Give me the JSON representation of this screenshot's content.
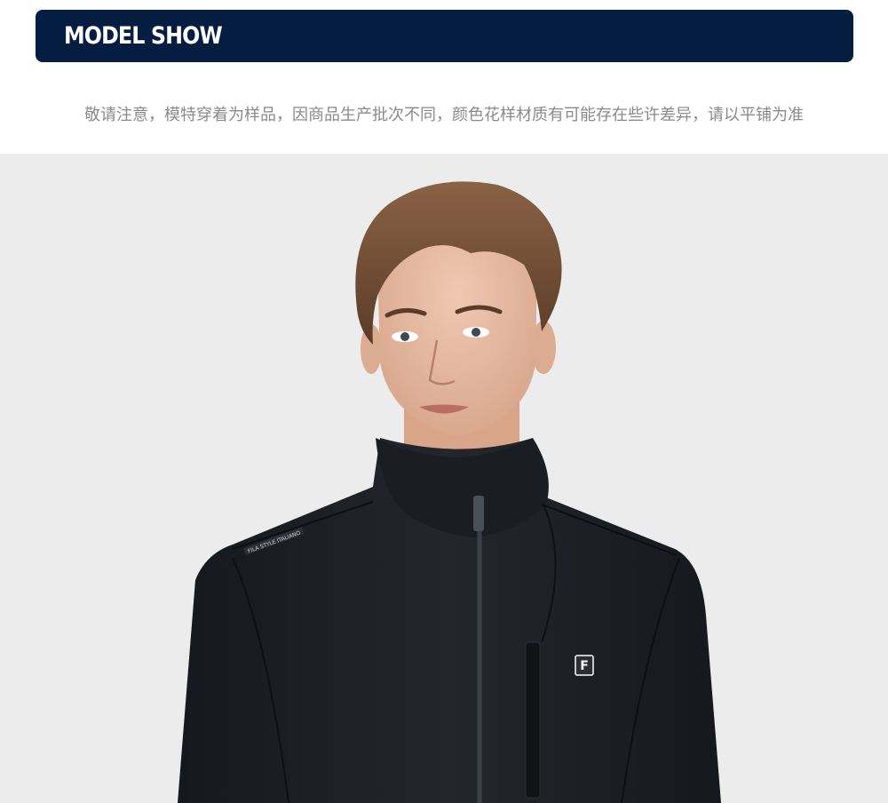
{
  "header": {
    "title": "MODEL SHOW"
  },
  "notice": {
    "text": "敬请注意，模特穿着为样品，因商品生产批次不同，颜色花样材质有可能存在些许差异，请以平铺为准"
  },
  "photo": {
    "background_color": "#ececec",
    "jacket_color": "#1c1f24",
    "hair_color": "#6b4a33",
    "skin_color": "#e6bba3",
    "shoulder_tape_text": "FILA STYLE ITALIANO",
    "chest_badge_text": "F"
  },
  "colors": {
    "header_bg": "#041d41",
    "header_text": "#ffffff",
    "notice_text": "#8a8a8a"
  }
}
